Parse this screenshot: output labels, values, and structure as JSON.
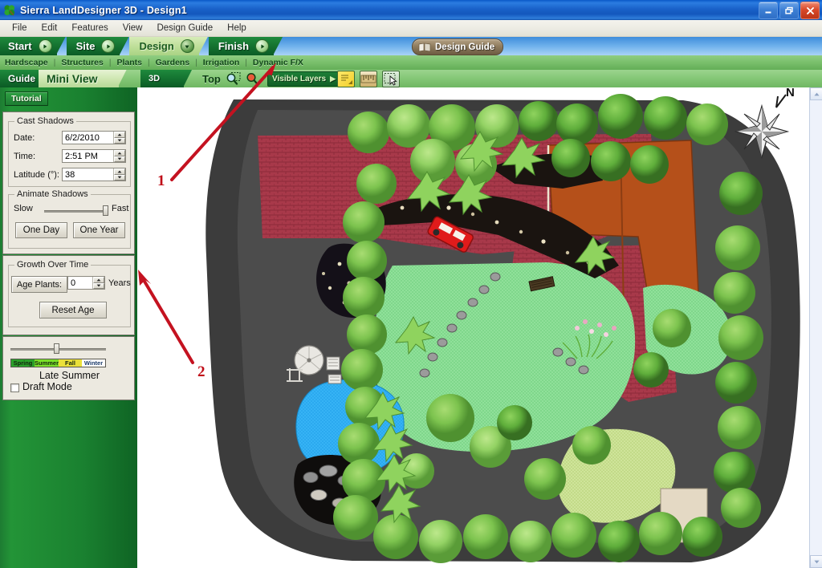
{
  "window": {
    "title": "Sierra LandDesigner 3D - Design1",
    "app_icon": "clover-leaf-icon",
    "controls": {
      "minimize": "Minimize",
      "restore": "Restore",
      "close": "Close"
    }
  },
  "menu": {
    "items": [
      "File",
      "Edit",
      "Features",
      "View",
      "Design Guide",
      "Help"
    ]
  },
  "ribbon": {
    "stages": [
      {
        "label": "Start",
        "active": false,
        "knob": "play-icon"
      },
      {
        "label": "Site",
        "active": false,
        "knob": "play-icon"
      },
      {
        "label": "Design",
        "active": true,
        "knob": "chevron-down-icon"
      },
      {
        "label": "Finish",
        "active": false,
        "knob": "play-icon"
      }
    ],
    "design_guide_button": {
      "label": "Design Guide",
      "icon": "book-icon"
    },
    "subtabs": [
      "Hardscape",
      "Structures",
      "Plants",
      "Gardens",
      "Irrigation",
      "Dynamic F/X"
    ],
    "subtab_separator": "|",
    "active_subtab": "Dynamic F/X"
  },
  "viewbar": {
    "guide_tab": "Guide",
    "mini_view_tab": "Mini View",
    "three_d_tab": "3D",
    "view_label": "Top",
    "zoom_in_icon": "magnifier-zoom-in-icon",
    "zoom_out_icon": "magnifier-zoom-out-icon",
    "visible_layers": {
      "label": "Visible Layers",
      "arrow": "triangle-right-icon"
    },
    "tool_icons": [
      "notes-icon",
      "ruler-measure-icon",
      "select-arrow-icon"
    ]
  },
  "left_panel": {
    "tutorial_button": "Tutorial",
    "cast_shadows": {
      "title": "Cast Shadows",
      "fields": [
        {
          "label": "Date:",
          "value": "6/2/2010"
        },
        {
          "label": "Time:",
          "value": "2:51 PM"
        },
        {
          "label": "Latitude (°):",
          "value": "38"
        }
      ]
    },
    "animate_shadows": {
      "title": "Animate Shadows",
      "slow_label": "Slow",
      "fast_label": "Fast",
      "slider_value": 88,
      "buttons": [
        "One Day",
        "One Year"
      ]
    },
    "growth_over_time": {
      "title": "Growth Over Time",
      "age_plants_label": "Age Plants:",
      "age_plants_value": "0",
      "years_label": "Years",
      "reset_button": "Reset Age"
    },
    "season": {
      "slider_value": 47,
      "segments": [
        {
          "label": "Spring",
          "color": "#2aa02a"
        },
        {
          "label": "Summer",
          "color": "#7ae02a"
        },
        {
          "label": "Fall",
          "color": "#eae03a"
        },
        {
          "label": "Winter",
          "color": "#ffffff"
        }
      ],
      "current_label": "Late Summer",
      "draft_mode_label": "Draft Mode",
      "draft_mode_checked": false
    }
  },
  "annotations": [
    {
      "number": "1",
      "target": "Dynamic F/X subtab"
    },
    {
      "number": "2",
      "target": "Growth Over Time group"
    }
  ],
  "canvas": {
    "view": "Top",
    "compass": {
      "label": "N",
      "icon": "compass-rose-icon"
    },
    "description": "Top-down landscape design plan"
  },
  "colors": {
    "title_blue": "#1961c8",
    "ribbon_green": "#13702f",
    "panel_green": "#1a8130",
    "accent_red": "#c00d18",
    "lawn": "#8fe09a",
    "paving": "#4a4a4a",
    "brick": "#a83a4a",
    "roof": "#b5501a",
    "pond": "#29a9ef"
  }
}
